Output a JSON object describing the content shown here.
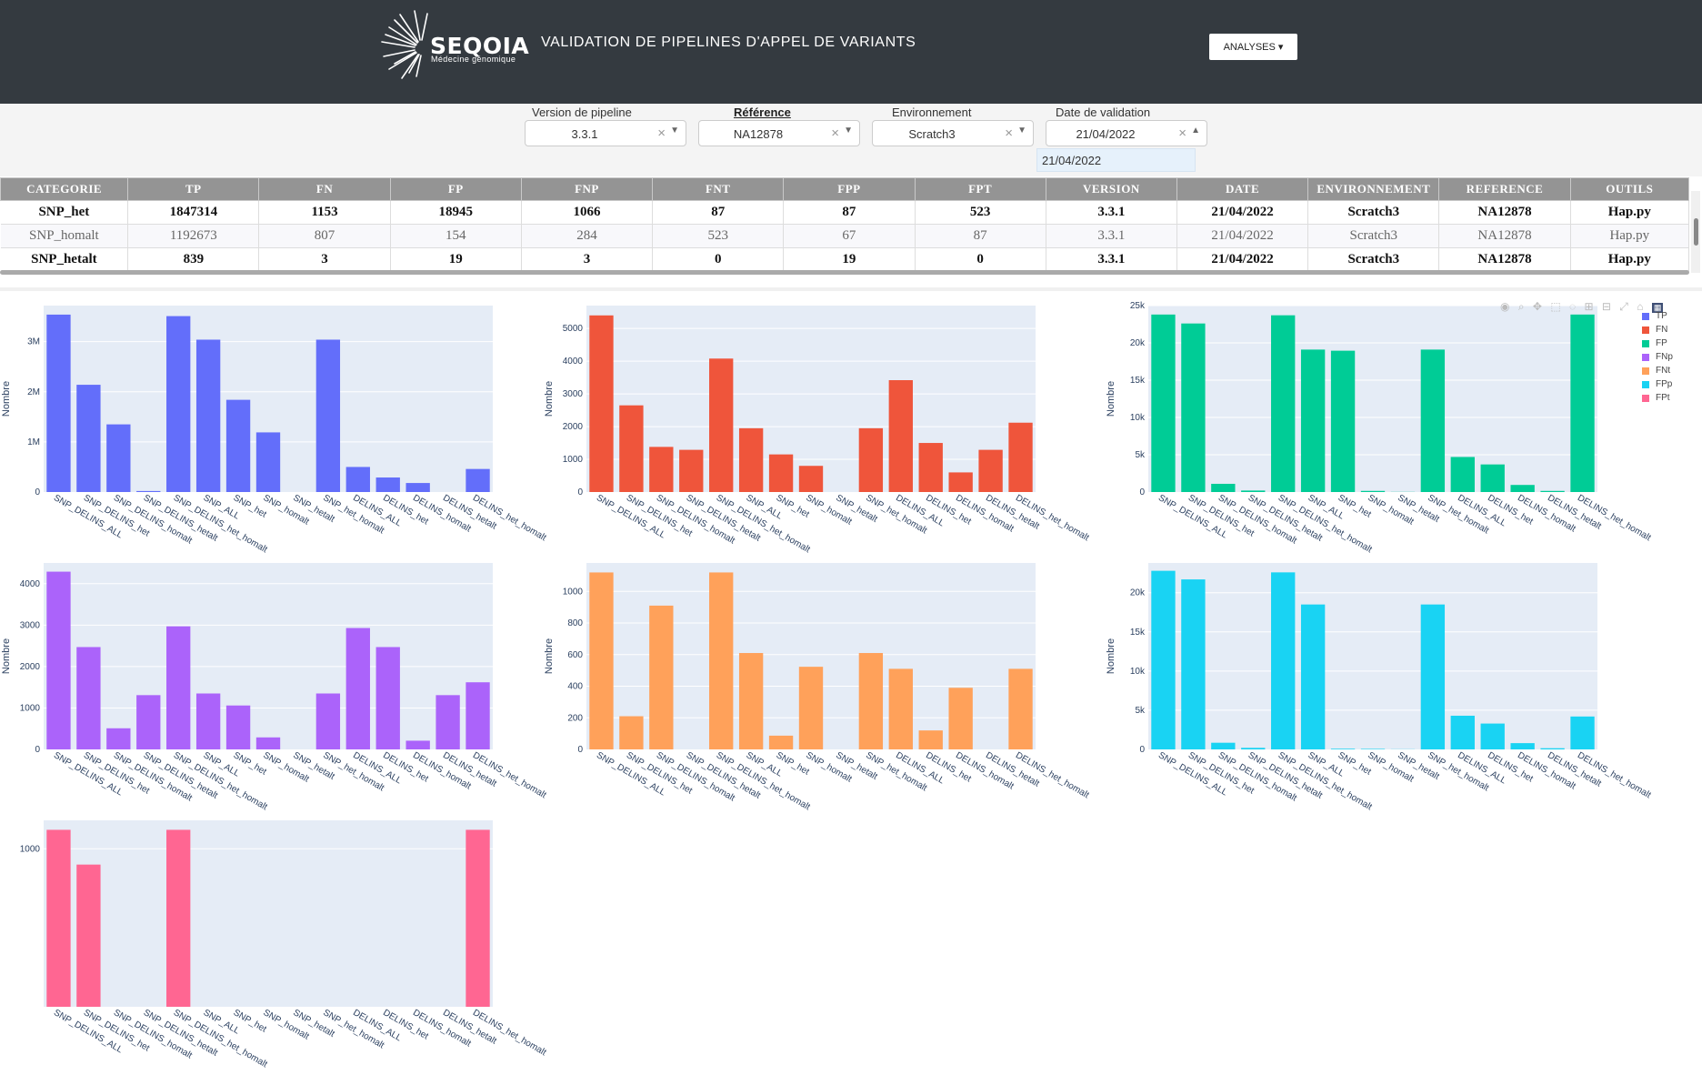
{
  "header": {
    "logo_text": "SEQOIA",
    "logo_subtitle": "Médecine génomique",
    "title": "VALIDATION DE PIPELINES D'APPEL DE VARIANTS",
    "analyses_label": "ANALYSES"
  },
  "filters": {
    "pipeline": {
      "label": "Version de pipeline",
      "value": "3.3.1"
    },
    "reference": {
      "label": "Référence",
      "value": "NA12878"
    },
    "environment": {
      "label": "Environnement",
      "value": "Scratch3"
    },
    "date": {
      "label": "Date de validation",
      "value": "21/04/2022"
    },
    "date_dropdown_option": "21/04/2022"
  },
  "table": {
    "columns": [
      "CATEGORIE",
      "TP",
      "FN",
      "FP",
      "FNP",
      "FNT",
      "FPP",
      "FPT",
      "VERSION",
      "DATE",
      "ENVIRONNEMENT",
      "REFERENCE",
      "OUTILS"
    ],
    "rows": [
      [
        "SNP_het",
        "1847314",
        "1153",
        "18945",
        "1066",
        "87",
        "87",
        "523",
        "3.3.1",
        "21/04/2022",
        "Scratch3",
        "NA12878",
        "Hap.py"
      ],
      [
        "SNP_homalt",
        "1192673",
        "807",
        "154",
        "284",
        "523",
        "67",
        "87",
        "3.3.1",
        "21/04/2022",
        "Scratch3",
        "NA12878",
        "Hap.py"
      ],
      [
        "SNP_hetalt",
        "839",
        "3",
        "19",
        "3",
        "0",
        "19",
        "0",
        "3.3.1",
        "21/04/2022",
        "Scratch3",
        "NA12878",
        "Hap.py"
      ]
    ]
  },
  "legend": {
    "items": [
      {
        "label": "TP",
        "color": "#636efa"
      },
      {
        "label": "FN",
        "color": "#ef553b"
      },
      {
        "label": "FP",
        "color": "#00cc96"
      },
      {
        "label": "FNp",
        "color": "#ab63fa"
      },
      {
        "label": "FNt",
        "color": "#ffa15a"
      },
      {
        "label": "FPp",
        "color": "#19d3f3"
      },
      {
        "label": "FPt",
        "color": "#ff6692"
      }
    ]
  },
  "modebar_icons": [
    "camera-icon",
    "zoom-icon",
    "pan-icon",
    "box-select-icon",
    "lasso-icon",
    "zoom-in-icon",
    "zoom-out-icon",
    "autoscale-icon",
    "reset-axes-icon",
    "plotly-logo-icon"
  ],
  "chart_data": [
    {
      "type": "bar",
      "series": [
        {
          "name": "TP",
          "values": [
            3540000,
            2140000,
            1350000,
            20000,
            3510000,
            3040000,
            1840000,
            1190000,
            0,
            3040000,
            500000,
            290000,
            180000,
            0,
            460000
          ]
        }
      ],
      "categories": [
        "SNP_DELINS_ALL",
        "SNP_DELINS_het",
        "SNP_DELINS_homalt",
        "SNP_DELINS_hetalt",
        "SNP_DELINS_het_homalt",
        "SNP_ALL",
        "SNP_het",
        "SNP_homalt",
        "SNP_hetalt",
        "SNP_het_homalt",
        "DELINS_ALL",
        "DELINS_het",
        "DELINS_homalt",
        "DELINS_hetalt",
        "DELINS_het_homalt"
      ],
      "ylabel": "Nombre",
      "ylim": [
        0,
        3720000
      ],
      "yticks": [
        0,
        1000000,
        2000000,
        3000000
      ],
      "yticklabels": [
        "0",
        "1M",
        "2M",
        "3M"
      ],
      "color": "#636efa"
    },
    {
      "type": "bar",
      "series": [
        {
          "name": "FN",
          "values": [
            5400,
            2650,
            1380,
            1290,
            4080,
            1950,
            1150,
            800,
            0,
            1950,
            3420,
            1500,
            600,
            1290,
            2120
          ]
        }
      ],
      "categories": [
        "SNP_DELINS_ALL",
        "SNP_DELINS_het",
        "SNP_DELINS_homalt",
        "SNP_DELINS_hetalt",
        "SNP_DELINS_het_homalt",
        "SNP_ALL",
        "SNP_het",
        "SNP_homalt",
        "SNP_hetalt",
        "SNP_het_homalt",
        "DELINS_ALL",
        "DELINS_het",
        "DELINS_homalt",
        "DELINS_hetalt",
        "DELINS_het_homalt"
      ],
      "ylabel": "Nombre",
      "ylim": [
        0,
        5700
      ],
      "yticks": [
        0,
        1000,
        2000,
        3000,
        4000,
        5000
      ],
      "yticklabels": [
        "0",
        "1000",
        "2000",
        "3000",
        "4000",
        "5000"
      ],
      "color": "#ef553b"
    },
    {
      "type": "bar",
      "series": [
        {
          "name": "FP",
          "values": [
            23800,
            22600,
            1100,
            200,
            23700,
            19100,
            18950,
            150,
            20,
            19100,
            4700,
            3700,
            950,
            150,
            23800
          ]
        }
      ],
      "categories": [
        "SNP_DELINS_ALL",
        "SNP_DELINS_het",
        "SNP_DELINS_homalt",
        "SNP_DELINS_hetalt",
        "SNP_DELINS_het_homalt",
        "SNP_ALL",
        "SNP_het",
        "SNP_homalt",
        "SNP_hetalt",
        "SNP_het_homalt",
        "DELINS_ALL",
        "DELINS_het",
        "DELINS_homalt",
        "DELINS_hetalt",
        "DELINS_het_homalt"
      ],
      "ylabel": "Nombre",
      "ylim": [
        0,
        25000
      ],
      "yticks": [
        0,
        5000,
        10000,
        15000,
        20000,
        25000
      ],
      "yticklabels": [
        "0",
        "5k",
        "10k",
        "15k",
        "20k",
        "25k"
      ],
      "color": "#00cc96"
    },
    {
      "type": "bar",
      "series": [
        {
          "name": "FNp",
          "values": [
            4290,
            2470,
            510,
            1310,
            2970,
            1350,
            1060,
            290,
            0,
            1350,
            2930,
            2470,
            210,
            1310,
            1620
          ]
        }
      ],
      "categories": [
        "SNP_DELINS_ALL",
        "SNP_DELINS_het",
        "SNP_DELINS_homalt",
        "SNP_DELINS_hetalt",
        "SNP_DELINS_het_homalt",
        "SNP_ALL",
        "SNP_het",
        "SNP_homalt",
        "SNP_hetalt",
        "SNP_het_homalt",
        "DELINS_ALL",
        "DELINS_het",
        "DELINS_homalt",
        "DELINS_hetalt",
        "DELINS_het_homalt"
      ],
      "ylabel": "Nombre",
      "ylim": [
        0,
        4500
      ],
      "yticks": [
        0,
        1000,
        2000,
        3000,
        4000
      ],
      "yticklabels": [
        "0",
        "1000",
        "2000",
        "3000",
        "4000"
      ],
      "color": "#ab63fa"
    },
    {
      "type": "bar",
      "series": [
        {
          "name": "FNt",
          "values": [
            1120,
            210,
            910,
            0,
            1120,
            610,
            87,
            523,
            0,
            610,
            510,
            120,
            390,
            0,
            510
          ]
        }
      ],
      "categories": [
        "SNP_DELINS_ALL",
        "SNP_DELINS_het",
        "SNP_DELINS_homalt",
        "SNP_DELINS_hetalt",
        "SNP_DELINS_het_homalt",
        "SNP_ALL",
        "SNP_het",
        "SNP_homalt",
        "SNP_hetalt",
        "SNP_het_homalt",
        "DELINS_ALL",
        "DELINS_het",
        "DELINS_homalt",
        "DELINS_hetalt",
        "DELINS_het_homalt"
      ],
      "ylabel": "Nombre",
      "ylim": [
        0,
        1180
      ],
      "yticks": [
        0,
        200,
        400,
        600,
        800,
        1000
      ],
      "yticklabels": [
        "0",
        "200",
        "400",
        "600",
        "800",
        "1000"
      ],
      "color": "#ffa15a"
    },
    {
      "type": "bar",
      "series": [
        {
          "name": "FPp",
          "values": [
            22800,
            21700,
            850,
            200,
            22600,
            18500,
            87,
            67,
            19,
            18500,
            4300,
            3300,
            800,
            150,
            4200
          ]
        }
      ],
      "categories": [
        "SNP_DELINS_ALL",
        "SNP_DELINS_het",
        "SNP_DELINS_homalt",
        "SNP_DELINS_hetalt",
        "SNP_DELINS_het_homalt",
        "SNP_ALL",
        "SNP_het",
        "SNP_homalt",
        "SNP_hetalt",
        "SNP_het_homalt",
        "DELINS_ALL",
        "DELINS_het",
        "DELINS_homalt",
        "DELINS_hetalt",
        "DELINS_het_homalt"
      ],
      "ylabel": "Nombre",
      "ylim": [
        0,
        23800
      ],
      "yticks": [
        0,
        5000,
        10000,
        15000,
        20000
      ],
      "yticklabels": [
        "0",
        "5k",
        "10k",
        "15k",
        "20k"
      ],
      "color": "#19d3f3"
    },
    {
      "type": "bar",
      "series": [
        {
          "name": "FPt",
          "values": [
            1120,
            900,
            0,
            0,
            1120,
            0,
            0,
            0,
            0,
            0,
            0,
            0,
            0,
            0,
            1120
          ]
        }
      ],
      "categories": [
        "SNP_DELINS_ALL",
        "SNP_DELINS_het",
        "SNP_DELINS_homalt",
        "SNP_DELINS_hetalt",
        "SNP_DELINS_het_homalt",
        "SNP_ALL",
        "SNP_het",
        "SNP_homalt",
        "SNP_hetalt",
        "SNP_het_homalt",
        "DELINS_ALL",
        "DELINS_het",
        "DELINS_homalt",
        "DELINS_hetalt",
        "DELINS_het_homalt"
      ],
      "ylabel": "",
      "ylim": [
        0,
        1180
      ],
      "yticks": [
        1000
      ],
      "yticklabels": [
        "1000"
      ],
      "color": "#ff6692"
    }
  ]
}
